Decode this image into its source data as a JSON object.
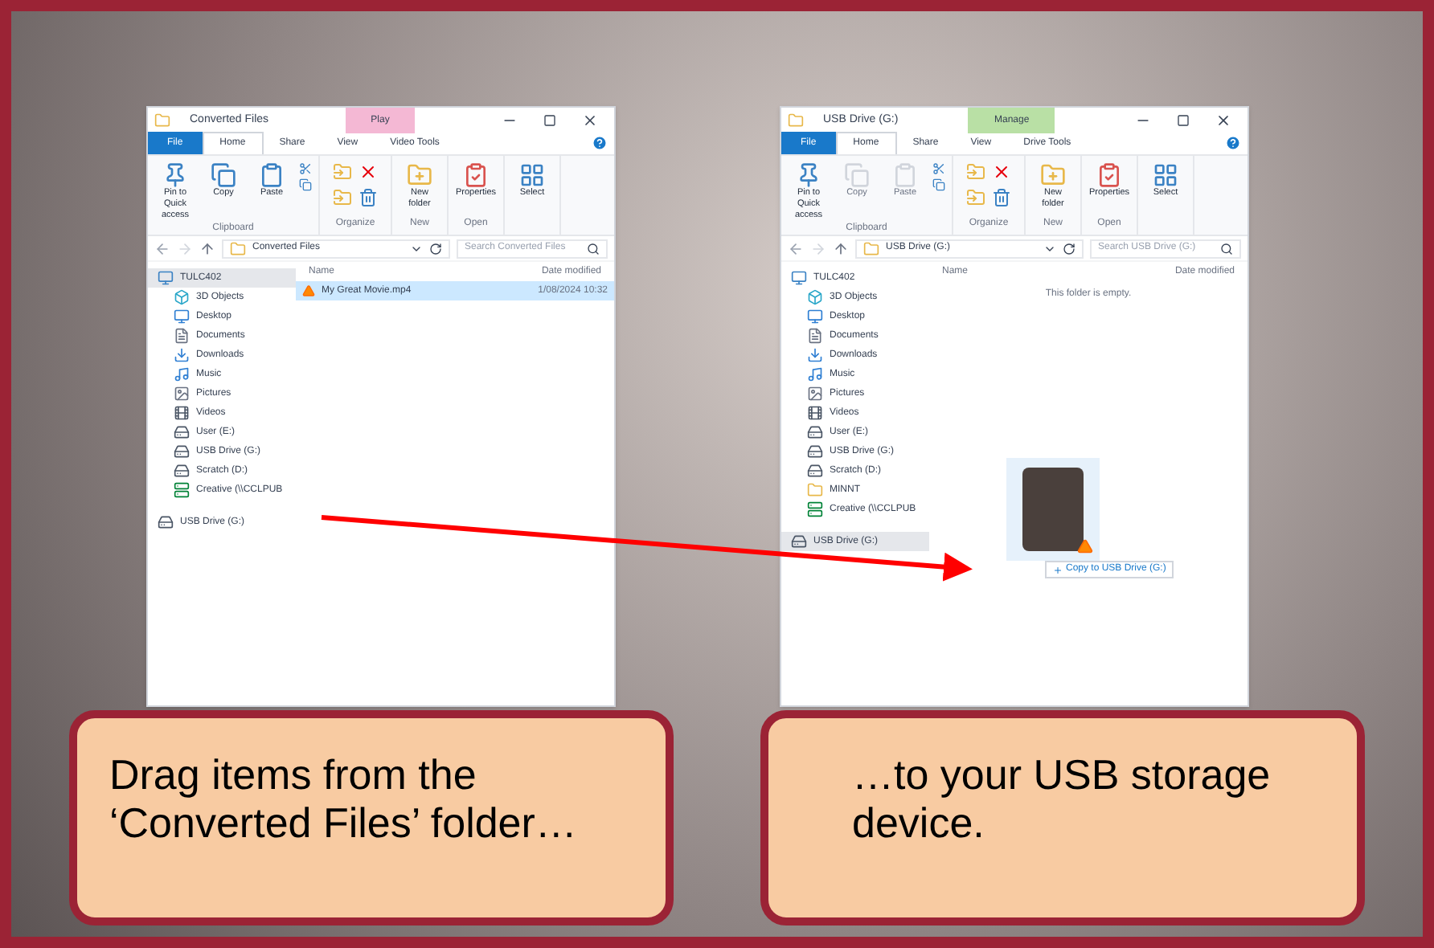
{
  "windows": [
    {
      "title": "Converted Files",
      "context_tab": {
        "label": "Play",
        "color": "#f4b8d4"
      },
      "tabs": [
        {
          "label": "File",
          "kind": "file",
          "selected": false
        },
        {
          "label": "Home",
          "kind": "tab",
          "selected": true
        },
        {
          "label": "Share",
          "kind": "tab",
          "selected": false
        },
        {
          "label": "View",
          "kind": "tab",
          "selected": false
        },
        {
          "label": "Video Tools",
          "kind": "tab",
          "selected": false
        }
      ],
      "ribbon_groups": [
        {
          "label": "Clipboard",
          "commands": [
            {
              "label": "Pin to Quick access",
              "kind": "pin",
              "disabled": false
            },
            {
              "label": "Copy",
              "kind": "copy",
              "disabled": false
            },
            {
              "label": "Paste",
              "kind": "paste",
              "disabled": false
            }
          ]
        },
        {
          "label": "Organize"
        },
        {
          "label": "New",
          "commands": [
            {
              "label": "New folder",
              "kind": "create",
              "disabled": false
            }
          ]
        },
        {
          "label": "Open",
          "commands": [
            {
              "label": "Properties",
              "kind": "properties",
              "disabled": false
            }
          ]
        },
        {
          "commands": [
            {
              "label": "Select",
              "kind": "select",
              "disabled": false
            }
          ]
        }
      ],
      "address": "Converted Files",
      "search_placeholder": "Search Converted Files",
      "columns": [
        "Name",
        "Date modified"
      ],
      "nav": [
        {
          "label": "TULC402",
          "kind": "pc",
          "selected": true
        },
        {
          "label": "3D Objects",
          "kind": "objects",
          "selected": false
        },
        {
          "label": "Desktop",
          "kind": "desktop",
          "selected": false
        },
        {
          "label": "Documents",
          "kind": "documents",
          "selected": false
        },
        {
          "label": "Downloads",
          "kind": "downloads",
          "selected": false
        },
        {
          "label": "Music",
          "kind": "music",
          "selected": false
        },
        {
          "label": "Pictures",
          "kind": "pictures",
          "selected": false
        },
        {
          "label": "Videos",
          "kind": "videos",
          "selected": false
        },
        {
          "label": "User (E:)",
          "kind": "drive",
          "selected": false
        },
        {
          "label": "USB Drive (G:)",
          "kind": "drive",
          "selected": false
        },
        {
          "label": "Scratch (D:)",
          "kind": "drive",
          "selected": false
        },
        {
          "label": "Creative (\\\\CCLPUB",
          "kind": "network",
          "selected": false
        },
        {
          "label": "USB Drive (G:)",
          "kind": "removable",
          "selected": false
        }
      ],
      "files": [
        {
          "name": "My Great Movie.mp4",
          "date": "1/08/2024 10:32",
          "selected": true
        }
      ]
    },
    {
      "title": "USB Drive (G:)",
      "context_tab": {
        "label": "Manage",
        "color": "#b9e0a5"
      },
      "tabs": [
        {
          "label": "File",
          "kind": "file",
          "selected": false
        },
        {
          "label": "Home",
          "kind": "tab",
          "selected": true
        },
        {
          "label": "Share",
          "kind": "tab",
          "selected": false
        },
        {
          "label": "View",
          "kind": "tab",
          "selected": false
        },
        {
          "label": "Drive Tools",
          "kind": "tab",
          "selected": false
        }
      ],
      "ribbon_groups": [
        {
          "label": "Clipboard",
          "commands": [
            {
              "label": "Pin to Quick access",
              "kind": "pin",
              "disabled": false
            },
            {
              "label": "Copy",
              "kind": "copy",
              "disabled": true
            },
            {
              "label": "Paste",
              "kind": "paste",
              "disabled": true
            }
          ]
        },
        {
          "label": "Organize"
        },
        {
          "label": "New",
          "commands": [
            {
              "label": "New folder",
              "kind": "create",
              "disabled": false
            }
          ]
        },
        {
          "label": "Open",
          "commands": [
            {
              "label": "Properties",
              "kind": "properties",
              "disabled": false
            }
          ]
        },
        {
          "commands": [
            {
              "label": "Select",
              "kind": "select",
              "disabled": false
            }
          ]
        }
      ],
      "address": "USB Drive (G:)",
      "search_placeholder": "Search USB Drive (G:)",
      "columns": [
        "Name",
        "Date modified"
      ],
      "nav": [
        {
          "label": "TULC402",
          "kind": "pc",
          "selected": false
        },
        {
          "label": "3D Objects",
          "kind": "objects",
          "selected": false
        },
        {
          "label": "Desktop",
          "kind": "desktop",
          "selected": false
        },
        {
          "label": "Documents",
          "kind": "documents",
          "selected": false
        },
        {
          "label": "Downloads",
          "kind": "downloads",
          "selected": false
        },
        {
          "label": "Music",
          "kind": "music",
          "selected": false
        },
        {
          "label": "Pictures",
          "kind": "pictures",
          "selected": false
        },
        {
          "label": "Videos",
          "kind": "videos",
          "selected": false
        },
        {
          "label": "User (E:)",
          "kind": "drive",
          "selected": false
        },
        {
          "label": "USB Drive (G:)",
          "kind": "drive",
          "selected": false
        },
        {
          "label": "Scratch (D:)",
          "kind": "drive",
          "selected": false
        },
        {
          "label": "MINNT",
          "kind": "folder",
          "selected": false
        },
        {
          "label": "Creative (\\\\CCLPUB",
          "kind": "network",
          "selected": false
        },
        {
          "label": "USB Drive (G:)",
          "kind": "removable",
          "selected": true
        }
      ],
      "empty_text": "This folder is empty.",
      "drag_tooltip": "Copy to USB Drive (G:)"
    }
  ],
  "callouts": [
    "Drag items from the ‘Converted Files’ folder…",
    "…to your USB storage device."
  ]
}
